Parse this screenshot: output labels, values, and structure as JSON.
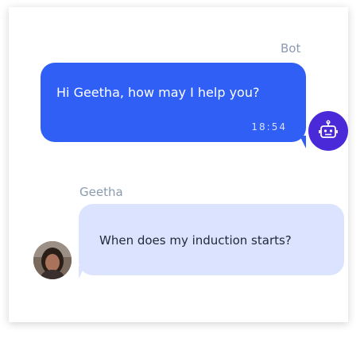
{
  "bot": {
    "sender": "Bot",
    "message": "Hi Geetha, how may I help you?",
    "time": "18:54",
    "avatar_icon": "robot-icon",
    "bubble_color": "#2f5ff5",
    "avatar_color": "#4a2ad8"
  },
  "user": {
    "sender": "Geetha",
    "message": "When does my induction starts?",
    "bubble_color": "#dce3ff"
  }
}
